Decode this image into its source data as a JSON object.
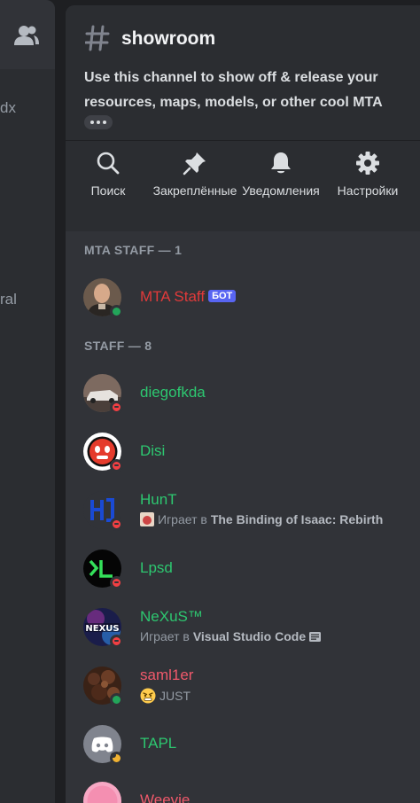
{
  "left_strip": {
    "text_1": "dx",
    "text_2": "ral"
  },
  "channel": {
    "name": "showroom",
    "topic": "Use this channel to show off & release your resources, maps, models, or other cool MTA"
  },
  "actions": [
    {
      "label": "Поиск",
      "icon": "search-icon"
    },
    {
      "label": "Закреплённые",
      "icon": "pin-icon"
    },
    {
      "label": "Уведомления",
      "icon": "bell-icon"
    },
    {
      "label": "Настройки",
      "icon": "gear-icon"
    }
  ],
  "sections": {
    "mta_staff": "MTA STAFF — 1",
    "staff": "STAFF — 8"
  },
  "members": [
    {
      "name": "MTA Staff",
      "badge": "БОТ",
      "status": "online",
      "color": "#e13a3a"
    },
    {
      "name": "diegofkda",
      "status": "dnd",
      "color": "#2dc770"
    },
    {
      "name": "Disi",
      "status": "dnd",
      "color": "#2dc770"
    },
    {
      "name": "HunT",
      "status": "dnd",
      "color": "#2dc770",
      "activity_prefix": "Играет в",
      "activity": "The Binding of Isaac: Rebirth"
    },
    {
      "name": "Lpsd",
      "status": "dnd",
      "color": "#2dc770"
    },
    {
      "name": "NeXuS™",
      "status": "dnd",
      "color": "#2dc770",
      "activity_prefix": "Играет в",
      "activity": "Visual Studio Code"
    },
    {
      "name": "saml1er",
      "status": "online",
      "color": "#f0596b",
      "custom_status": "JUST"
    },
    {
      "name": "TAPL",
      "status": "idle",
      "color": "#2dc770"
    },
    {
      "name": "Weevie",
      "color": "#f0596b"
    }
  ]
}
